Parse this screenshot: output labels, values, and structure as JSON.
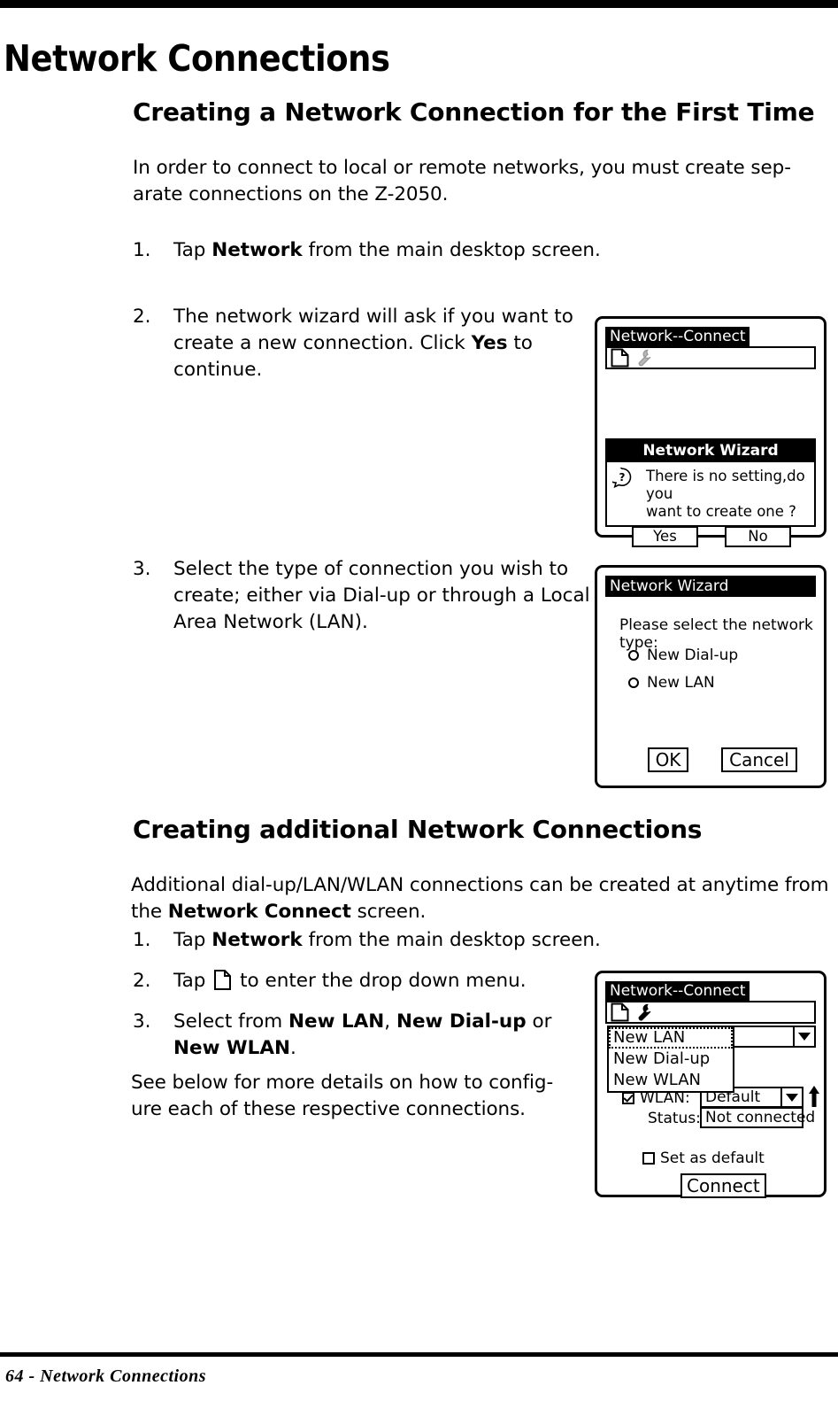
{
  "page": {
    "title": "Network Connections",
    "footer": "64  -  Network Connections"
  },
  "sections": {
    "first_time": {
      "heading": "Creating a Network Connection for the First Time",
      "intro_line1": "In order to connect to local or remote networks, you must create sep-",
      "intro_line2": "arate connections on the Z-2050.",
      "steps": [
        {
          "number": "1.",
          "text_parts": [
            "Tap ",
            "Network",
            " from the main desktop screen."
          ]
        },
        {
          "number": "2.",
          "text_parts": [
            "The network wizard will ask if you want to create a new connection. Click ",
            "Yes",
            " to continue."
          ]
        },
        {
          "number": "3.",
          "text_parts": [
            "Select the type of connection you wish to create; either via Dial-up or through a Local Area Network (LAN).",
            "",
            ""
          ]
        }
      ],
      "step1_pre": "Tap ",
      "step1_bold": "Network",
      "step1_post": " from the main desktop screen.",
      "step2_pre": "The network wizard will ask if you want to create a new connection. Click ",
      "step2_bold": "Yes",
      "step2_post": " to continue.",
      "step3_text": "Select the type of connection you wish to create; either via Dial-up or through a Local Area Network (LAN)."
    },
    "additional": {
      "heading": "Creating additional Network Connections",
      "intro_pre": "Additional dial-up/LAN/WLAN connections can be created at anytime from the ",
      "intro_bold": "Network Connect",
      "intro_post": " screen.",
      "step1_num": "1.",
      "step1_pre": "Tap ",
      "step1_bold": "Network",
      "step1_post": " from the main desktop screen.",
      "step2_num": "2.",
      "step2_pre": "Tap ",
      "step2_post": " to enter the drop down menu.",
      "step3_num": "3.",
      "step3_pre": "Select from ",
      "step3_bold1": "New LAN",
      "step3_mid1": ", ",
      "step3_bold2": "New Dial-up",
      "step3_mid2": " or ",
      "step3_bold3": "New WLAN",
      "step3_post": ".",
      "closing_line1": "See below for more details on how to config-",
      "closing_line2": "ure each of these respective connections."
    }
  },
  "screenshots": {
    "connect_wizard_prompt": {
      "window_title": "Network--Connect",
      "toolbar_icons": [
        "page-icon",
        "wrench-icon"
      ],
      "dialog": {
        "title": "Network Wizard",
        "icon": "question-icon",
        "message_line1": "There is no setting,do you",
        "message_line2": "want to create one ?",
        "buttons": [
          "Yes",
          "No"
        ]
      }
    },
    "network_type_wizard": {
      "title": "Network Wizard",
      "prompt": "Please select the network type:",
      "options": [
        "New Dial-up",
        "New LAN"
      ],
      "buttons": [
        "OK",
        "Cancel"
      ]
    },
    "connect_dropdown": {
      "window_title": "Network--Connect",
      "toolbar_icons": [
        "page-icon",
        "wrench-icon"
      ],
      "menu_items": [
        "New LAN",
        "New Dial-up",
        "New WLAN"
      ],
      "menu_selected": "New LAN",
      "wlan_label": "WLAN:",
      "wlan_checked": true,
      "wlan_value": "Default",
      "status_label": "Status:",
      "status_value": "Not connected",
      "set_default_label": "Set as default",
      "set_default_checked": false,
      "connect_button": "Connect",
      "up_arrow_icon": "up-arrow-icon"
    }
  }
}
